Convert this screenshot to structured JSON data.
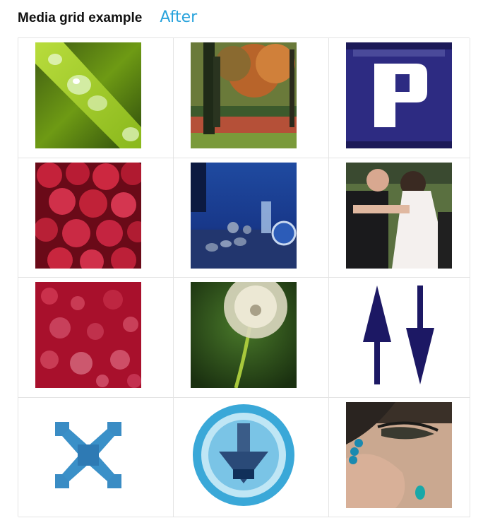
{
  "header": {
    "title": "Media grid example",
    "subtitle": "After"
  },
  "grid": {
    "items": [
      {
        "icon": "water-drops-on-leaf-photo"
      },
      {
        "icon": "autumn-forest-photo"
      },
      {
        "icon": "pixel-letter-p-icon"
      },
      {
        "icon": "raspberries-photo"
      },
      {
        "icon": "blue-clocks-still-life-photo"
      },
      {
        "icon": "wedding-couple-photo"
      },
      {
        "icon": "red-bokeh-photo"
      },
      {
        "icon": "dandelion-photo"
      },
      {
        "icon": "up-down-arrows-icon"
      },
      {
        "icon": "blue-x-close-icon"
      },
      {
        "icon": "blue-download-circle-icon"
      },
      {
        "icon": "face-closeup-photo"
      }
    ]
  }
}
